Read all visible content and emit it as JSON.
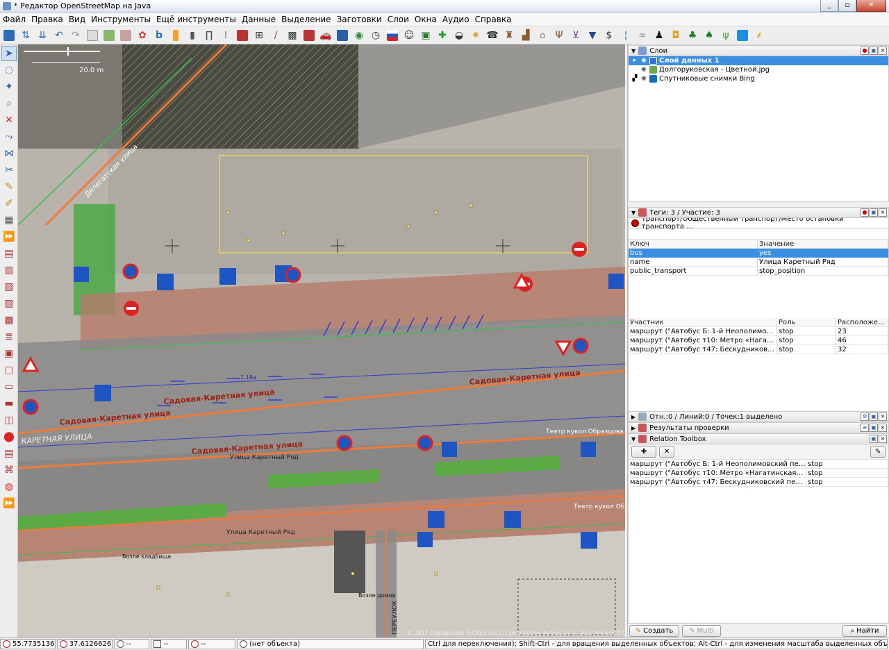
{
  "window": {
    "title": "* Редактор OpenStreetMap на Java",
    "min_label": "_",
    "max_label": "▫",
    "close_label": "✕"
  },
  "menu": [
    "Файл",
    "Правка",
    "Вид",
    "Инструменты",
    "Ещё инструменты",
    "Данные",
    "Выделение",
    "Заготовки",
    "Слои",
    "Окна",
    "Аудио",
    "Справка"
  ],
  "toolbar_icons": [
    "open-file",
    "upload",
    "download",
    "undo",
    "redo",
    "preferences",
    "imagery-1",
    "imagery-2",
    "imagery-3",
    "bing",
    "traffic-light",
    "gate",
    "barrier",
    "bollard",
    "wall",
    "fence",
    "hedge",
    "tracks",
    "car",
    "info",
    "globe",
    "flag",
    "theatre",
    "bench",
    "pharmacy",
    "toilets",
    "telephone",
    "castle",
    "industry",
    "house",
    "restaurant",
    "shop",
    "clothes",
    "money",
    "dentist",
    "link",
    "person",
    "bag",
    "trees",
    "forest",
    "grass",
    "water",
    "wheat"
  ],
  "left_tools": [
    "select",
    "lasso",
    "draw-node",
    "zoom",
    "delete",
    "improve-way",
    "merge",
    "split",
    "draw",
    "paint",
    "building",
    "more",
    "l1",
    "l2",
    "l3",
    "l4",
    "l5",
    "l6",
    "l7",
    "l8",
    "l9",
    "l10",
    "l11",
    "l12",
    "l13",
    "l14",
    "l15"
  ],
  "map": {
    "scale_label": "20.0 m",
    "labels": {
      "street1": "Садовая-Каретная улица",
      "street2": "Садовая-Каретная улица",
      "street3": "Садовая-Каретная улица",
      "street4": "Делегатская улица",
      "street5": "КАРЕТНАЯ УЛИЦА",
      "stop1": "Улица Каретный Ряд",
      "stop2": "Улица Каретный Ряд",
      "stop3": "Театр кукол Образцова",
      "stop4": "Театр кукол Образцова",
      "tag1": "1.18a",
      "tag2": "3.24",
      "tag3": "5.15.1",
      "credit": "© 2017 DigitalGlobe ©CNES (2017) Distribution Airbus DS © 2017 Microsoft Corporation",
      "ped": "Возле кладбища",
      "road_small": "ПЕРЕУЛОК",
      "bus": "Возле домов"
    }
  },
  "layers_panel": {
    "title": "Слои",
    "layers": [
      {
        "name": "Слой данных 1",
        "selected": true
      },
      {
        "name": "Долгоруковская - Цветной.jpg",
        "selected": false
      },
      {
        "name": "Спутниковые снимки Bing",
        "selected": false
      }
    ]
  },
  "tags_panel": {
    "title": "Теги: 3 / Участие: 3",
    "preset": "Транспорт/Общественный транспорт/Место остановки транспорта ...",
    "headers": {
      "key": "Ключ",
      "value": "Значение"
    },
    "rows": [
      {
        "key": "bus",
        "value": "yes",
        "selected": true
      },
      {
        "key": "name",
        "value": "Улица Каретный Ряд",
        "selected": false
      },
      {
        "key": "public_transport",
        "value": "stop_position",
        "selected": false
      }
    ],
    "member_headers": {
      "member": "Участник",
      "role": "Роль",
      "position": "Расположение"
    },
    "members": [
      {
        "member": "маршрут (\"Автобус Б: 1-й Неополимовский переулок =>",
        "role": "stop",
        "position": "23"
      },
      {
        "member": "маршрут (\"Автобус т10: Метро «Нагатинская» =>",
        "role": "stop",
        "position": "46"
      },
      {
        "member": "маршрут (\"Автобус т47: Бескудниковский переулок",
        "role": "stop",
        "position": "32"
      }
    ]
  },
  "selection_panel": {
    "title": "Отн.:0 / Линий:0 / Точек:1 выделено"
  },
  "validation_panel": {
    "title": "Результаты проверки"
  },
  "relation_panel": {
    "title": "Relation Toolbox",
    "rows": [
      {
        "member": "маршрут (\"Автобус Б: 1-й Неополимовский переулок =>...",
        "role": "stop"
      },
      {
        "member": "маршрут (\"Автобус т10: Метро «Нагатинская» => Само...",
        "role": "stop"
      },
      {
        "member": "маршрут (\"Автобус т47: Бескудниковский переулок =>...",
        "role": "stop"
      }
    ]
  },
  "bottom_buttons": {
    "create": "Создать",
    "multi": "Multi",
    "find": "Найти"
  },
  "status": {
    "lat": "55.7735136",
    "lon": "37.6126626",
    "heading": "--",
    "angle": "--",
    "dist": "--",
    "object": "(нет объекта)",
    "hint": "Ctrl для переключения); Shift-Ctrl - для вращения выделенных объектов; Alt-Ctrl - для изменения масштаба выделенных объектов; или для изменения выделения"
  },
  "colors": {
    "selection": "#3b8fe3",
    "road": "#f07a3a",
    "building_outline": "#e8d36a"
  }
}
